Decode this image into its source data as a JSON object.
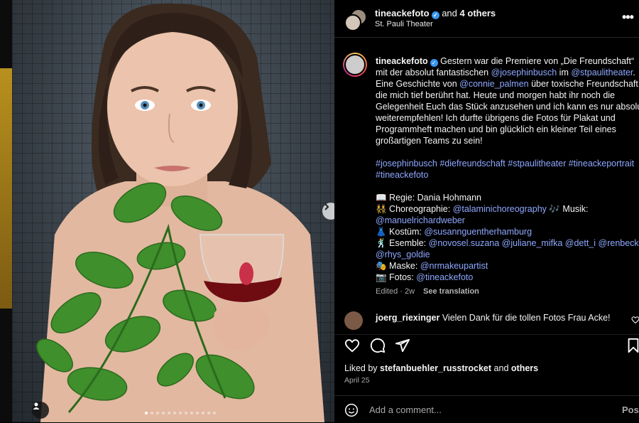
{
  "header": {
    "username": "tineackefoto",
    "collab_text": "and",
    "collab_others": "4 others",
    "location": "St. Pauli Theater",
    "more_icon": "•••"
  },
  "caption": {
    "username": "tineackefoto",
    "lines": [
      [
        "Gestern war die Premiere von „Die Freundschaft“"
      ],
      [
        "mit der absolut fantastischen ",
        "@josephinbusch",
        " im ",
        "@stpaulitheater",
        "."
      ],
      [
        "Eine Geschichte von ",
        "@connie_palmen",
        " über toxische Freundschaft,"
      ],
      [
        "die mich tief berührt hat. Heute und morgen habt ihr noch die"
      ],
      [
        "Gelegenheit Euch das Stück anzusehen und ich kann es nur absolut"
      ],
      [
        "weiterempfehlen! Ich durfte übrigens die Fotos für Plakat und"
      ],
      [
        "Programmheft machen und bin glücklich ein kleiner Teil eines"
      ],
      [
        "großartigen Teams zu sein!"
      ]
    ],
    "hashtags_line1": "#josephinbusch #diefreundschaft #stpaulitheater #tineackeportrait",
    "hashtags_line2": "#tineackefoto",
    "credits": {
      "regie": "📖 Regie: Dania Hohmann",
      "choreo_label": "👯 Choreographie: ",
      "choreo_link": "@talaminichoreography",
      "music_label": " 🎶 Musik:",
      "music_link": "@manuelrichardweber",
      "kostum_label": "👗 Kostüm: ",
      "kostum_link": "@susannguentherhamburg",
      "esemble_label": "🕺 Esemble: ",
      "esemble_links": "@novosel.suzana @juliane_mifka @dett_i @renbecker",
      "esemble_link2": "@rhys_goldie",
      "maske_label": "🎭 Maske: ",
      "maske_link": "@nrmakeupartist",
      "fotos_label": "📷 Fotos: ",
      "fotos_link": "@tineackefoto"
    },
    "edited": "Edited · 2w",
    "see_translation": "See translation"
  },
  "comment": {
    "username": "joerg_riexinger",
    "text": "Vielen Dank für die tollen Fotos Frau Acke!"
  },
  "likes": {
    "prefix": "Liked by",
    "user": "stefanbuehler_russtrocket",
    "and": "and",
    "others": "others"
  },
  "date": "April 25",
  "add_comment": {
    "placeholder": "Add a comment...",
    "post_label": "Post"
  },
  "carousel": {
    "dot_count": 13,
    "active_index": 0
  },
  "colors": {
    "link": "#8ea8ff",
    "verified": "#3897f0",
    "panel_bg": "#000000"
  }
}
